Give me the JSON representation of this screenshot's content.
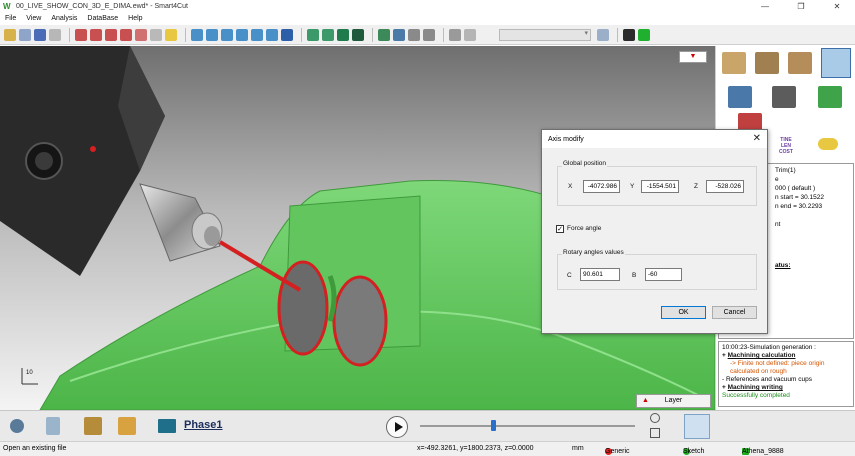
{
  "window": {
    "app_icon": "W",
    "title": "00_LIVE_SHOW_CON_3D_E_DIMA.ewd* - Smart4Cut",
    "minimize": "—",
    "maximize": "❐",
    "close": "✕"
  },
  "menu": [
    "File",
    "View",
    "Analysis",
    "DataBase",
    "Help"
  ],
  "viewport": {
    "marker": "▼",
    "axis_label": "10",
    "layer_button": "Layer"
  },
  "dialog": {
    "title": "Axis modify",
    "global_position_label": "Global position",
    "x_label": "X",
    "x_value": "-4072.986",
    "y_label": "Y",
    "y_value": "-1554.501",
    "z_label": "Z",
    "z_value": "-528.026",
    "force_angle_label": "Force angle",
    "force_angle_checked": true,
    "rotary_label": "Rotary angles values",
    "c_label": "C",
    "c_value": "90.601",
    "b_label": "B",
    "b_value": "-60",
    "ok_label": "OK",
    "cancel_label": "Cancel"
  },
  "right_panel": {
    "tool_label": "TINE\nLEN\nCOST",
    "info_lines": [
      "Trim(1)",
      "e",
      "000 ( default )",
      "n start = 30.1522",
      "n end = 30.2293",
      "",
      "nt",
      "",
      "",
      "atus:"
    ],
    "log": {
      "header": "10:00:23-Simulation generation :",
      "items": [
        {
          "kind": "bold",
          "text": "Machining calculation"
        },
        {
          "kind": "warn",
          "text": "-> Finite not defined: piece origin"
        },
        {
          "kind": "warn",
          "text": "calculated on rough"
        },
        {
          "kind": "plain",
          "text": "- References and vacuum cups"
        },
        {
          "kind": "bold",
          "text": "Machining writing"
        },
        {
          "kind": "ok",
          "text": "Successfully completed"
        }
      ]
    }
  },
  "bottom": {
    "phase_label": "Phase1",
    "slider_position_fraction": 0.34
  },
  "status": {
    "message": "Open an existing file",
    "coords": "x=-492.3261, y=1800.2373, z=0.0000",
    "unit": "mm",
    "mode": "Generic",
    "view": "Sketch",
    "user": "Athena_9888"
  },
  "colors": {
    "part_green": "#5ec85a",
    "accent_red": "#d42020",
    "status_dot_red": "#d22",
    "status_dot_green": "#2a2"
  }
}
